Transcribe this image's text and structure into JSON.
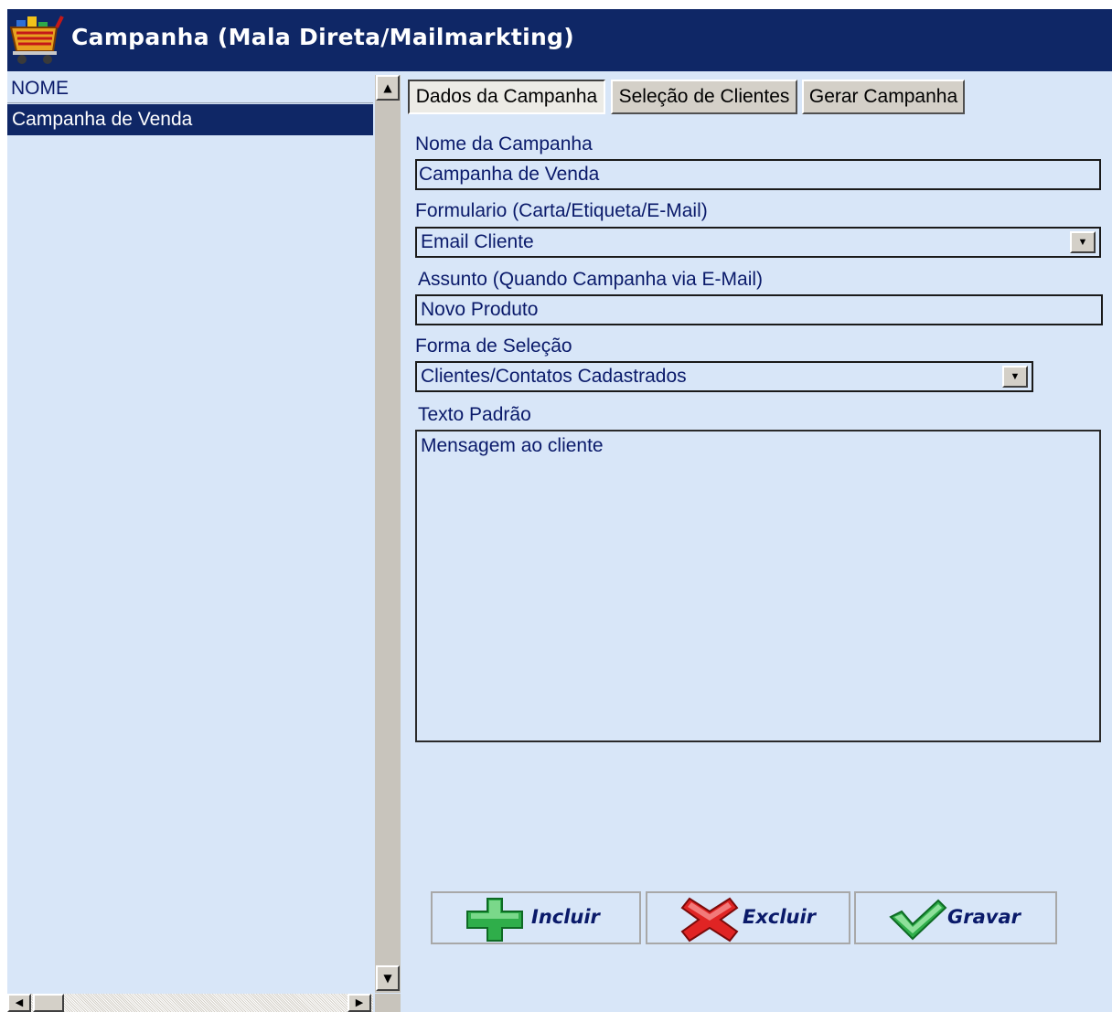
{
  "window": {
    "title": "Campanha (Mala Direta/Mailmarkting)"
  },
  "list": {
    "header": "NOME",
    "rows": [
      "Campanha de Venda"
    ]
  },
  "tabs": [
    "Dados da Campanha",
    "Seleção de Clientes",
    "Gerar Campanha"
  ],
  "form": {
    "nome_label": "Nome da Campanha",
    "nome_value": "Campanha de Venda",
    "formulario_label": "Formulario (Carta/Etiqueta/E-Mail)",
    "formulario_value": "Email Cliente",
    "assunto_label": "Assunto (Quando Campanha via E-Mail)",
    "assunto_value": "Novo Produto",
    "selecao_label": "Forma de Seleção",
    "selecao_value": "Clientes/Contatos Cadastrados",
    "texto_label": "Texto Padrão",
    "texto_value": "Mensagem ao cliente"
  },
  "actions": {
    "incluir": "Incluir",
    "excluir": "Excluir",
    "gravar": "Gravar"
  },
  "colors": {
    "titlebar": "#0f2766",
    "panel": "#d8e6f8",
    "text": "#0a1a6a"
  },
  "icons": [
    "shopping-cart-icon",
    "plus-icon",
    "x-icon",
    "check-icon"
  ]
}
